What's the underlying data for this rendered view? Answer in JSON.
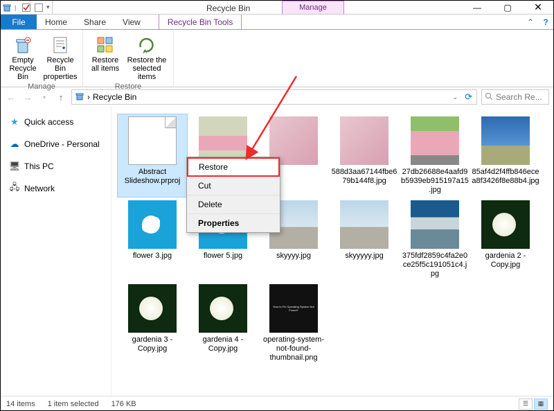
{
  "title": "Recycle Bin",
  "tabs": {
    "file": "File",
    "home": "Home",
    "share": "Share",
    "view": "View",
    "manage": "Manage",
    "tools": "Recycle Bin Tools"
  },
  "ribbon": {
    "manage_group": "Manage",
    "restore_group": "Restore",
    "empty": "Empty Recycle Bin",
    "properties": "Recycle Bin properties",
    "restore_all": "Restore all items",
    "restore_sel": "Restore the selected items"
  },
  "address": {
    "location": "Recycle Bin",
    "sep": "›"
  },
  "search": {
    "placeholder": "Search Re..."
  },
  "nav": {
    "quick": "Quick access",
    "onedrive": "OneDrive - Personal",
    "thispc": "This PC",
    "network": "Network"
  },
  "files": [
    {
      "name": "Abstract Slideshow.prproj",
      "kind": "doc",
      "selected": true
    },
    {
      "name": "",
      "kind": "flowers1"
    },
    {
      "name": "",
      "kind": "flowers2"
    },
    {
      "name": "588d3aa67144fbe679b144f8.jpg",
      "kind": "flowers2"
    },
    {
      "name": "27db26688e4aafd9b5939eb915197a15.jpg",
      "kind": "vase"
    },
    {
      "name": "85af4d2f4ffb846ecea8f3426f8e88b4.jpg",
      "kind": "sky"
    },
    {
      "name": "flower 3.jpg",
      "kind": "blueflower"
    },
    {
      "name": "flower 5.jpg",
      "kind": "blueflower"
    },
    {
      "name": "skyyyy.jpg",
      "kind": "sky2"
    },
    {
      "name": "skyyyyy.jpg",
      "kind": "sky2"
    },
    {
      "name": "375fdf2859c4fa2e0ce25f5c191051c4.jpg",
      "kind": "city"
    },
    {
      "name": "gardenia 2 - Copy.jpg",
      "kind": "gardenia"
    },
    {
      "name": "gardenia 3 - Copy.jpg",
      "kind": "gardenia"
    },
    {
      "name": "gardenia 4 - Copy.jpg",
      "kind": "gardenia"
    },
    {
      "name": "operating-system-not-found-thumbnail.png",
      "kind": "black"
    }
  ],
  "contextmenu": {
    "restore": "Restore",
    "cut": "Cut",
    "delete": "Delete",
    "properties": "Properties"
  },
  "status": {
    "count": "14 items",
    "selected": "1 item selected",
    "size": "176 KB"
  }
}
